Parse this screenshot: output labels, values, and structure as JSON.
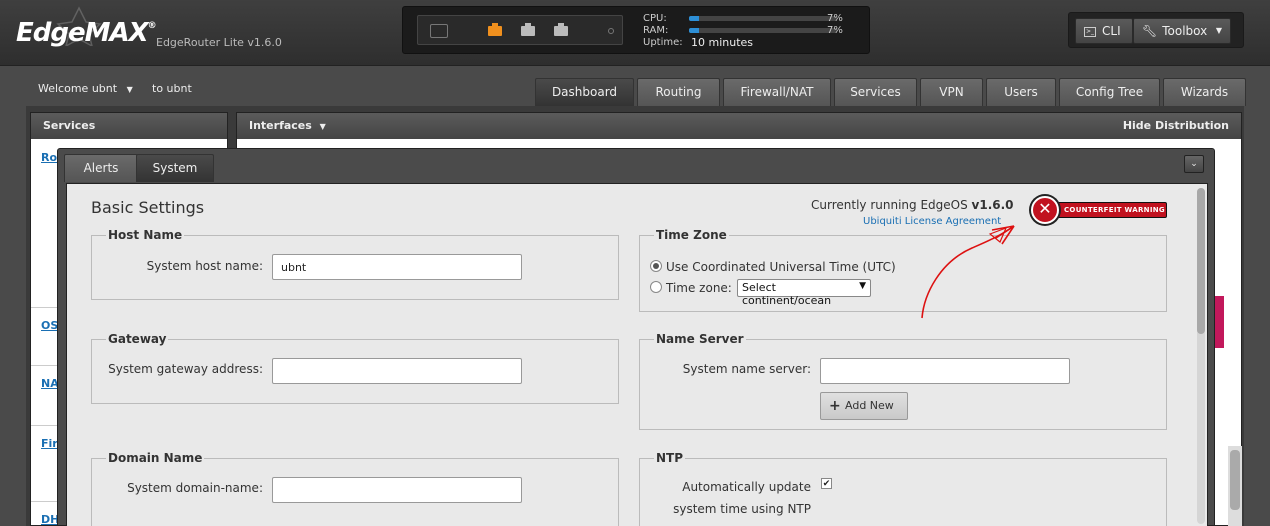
{
  "header": {
    "logo_text": "EdgeMAX",
    "logo_mark": "®",
    "model": "EdgeRouter Lite v1.6.0",
    "cpu_label": "CPU:",
    "cpu_value": "7%",
    "cpu_percent": 7,
    "ram_label": "RAM:",
    "ram_value": "7%",
    "ram_percent": 7,
    "uptime_label": "Uptime:",
    "uptime_value": "10 minutes",
    "ports": [
      {
        "name": "eth0",
        "color": "#f0901e"
      },
      {
        "name": "eth1",
        "color": "#bbbbbb"
      },
      {
        "name": "eth2",
        "color": "#bbbbbb"
      }
    ],
    "cli_label": "CLI",
    "toolbox_label": "Toolbox"
  },
  "nav": {
    "welcome": "Welcome ubnt",
    "to_user": "to ubnt",
    "tabs": [
      "Dashboard",
      "Routing",
      "Firewall/NAT",
      "Services",
      "VPN",
      "Users",
      "Config Tree",
      "Wizards"
    ]
  },
  "services_panel": {
    "title": "Services",
    "links": [
      "Ro",
      "OS",
      "NA",
      "Fir",
      "DH"
    ]
  },
  "interfaces_panel": {
    "title": "Interfaces",
    "hide_label": "Hide Distribution"
  },
  "dialog": {
    "tabs": [
      "Alerts",
      "System"
    ],
    "collapse_glyph": "⌄",
    "title": "Basic Settings",
    "running_prefix": "Currently running EdgeOS",
    "running_version": "v1.6.0",
    "license_link": "Ubiquiti License Agreement",
    "counterfeit": "COUNTERFEIT WARNING",
    "host": {
      "legend": "Host Name",
      "label": "System host name:",
      "value": "ubnt"
    },
    "gateway": {
      "legend": "Gateway",
      "label": "System gateway address:",
      "value": ""
    },
    "domain": {
      "legend": "Domain Name",
      "label": "System domain-name:",
      "value": ""
    },
    "timezone": {
      "legend": "Time Zone",
      "utc_label": "Use Coordinated Universal Time (UTC)",
      "zone_label": "Time zone:",
      "select_value": "Select continent/ocean"
    },
    "nameserver": {
      "legend": "Name Server",
      "label": "System name server:",
      "value": "",
      "add_label": "Add New"
    },
    "ntp": {
      "legend": "NTP",
      "label_line1": "Automatically update",
      "label_line2": "system time using NTP",
      "checked": true
    }
  },
  "colors": {
    "accent_blue": "#2d8fd6",
    "warning_red": "#c1121f",
    "link_blue": "#1a6fb3"
  }
}
